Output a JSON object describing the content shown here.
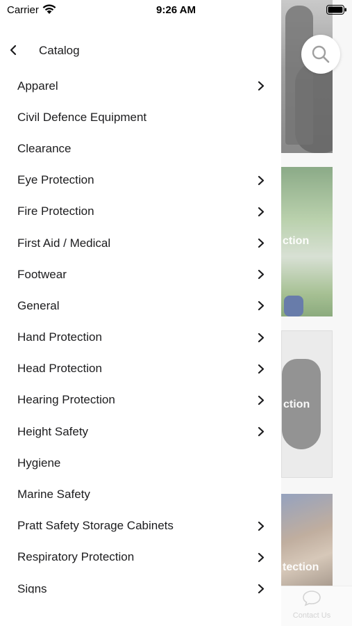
{
  "status_bar": {
    "carrier": "Carrier",
    "time": "9:26 AM"
  },
  "header": {
    "title": "Catalog"
  },
  "categories": [
    {
      "label": "Apparel",
      "has_children": true
    },
    {
      "label": "Civil Defence Equipment",
      "has_children": false
    },
    {
      "label": "Clearance",
      "has_children": false
    },
    {
      "label": "Eye Protection",
      "has_children": true
    },
    {
      "label": "Fire Protection",
      "has_children": true
    },
    {
      "label": "First Aid / Medical",
      "has_children": true
    },
    {
      "label": "Footwear",
      "has_children": true
    },
    {
      "label": "General",
      "has_children": true
    },
    {
      "label": "Hand Protection",
      "has_children": true
    },
    {
      "label": "Head Protection",
      "has_children": true
    },
    {
      "label": "Hearing Protection",
      "has_children": true
    },
    {
      "label": "Height Safety",
      "has_children": true
    },
    {
      "label": "Hygiene",
      "has_children": false
    },
    {
      "label": "Marine Safety",
      "has_children": false
    },
    {
      "label": "Pratt Safety Storage Cabinets",
      "has_children": true
    },
    {
      "label": "Respiratory Protection",
      "has_children": true
    },
    {
      "label": "Signs",
      "has_children": true
    }
  ],
  "background": {
    "card_captions": [
      "ction",
      "ction",
      "tection"
    ],
    "contact_tab_label": "Contact Us"
  },
  "colors": {
    "text": "#1c1c1e",
    "drawer_background": "#ffffff",
    "tab_inactive": "#c3c3c3"
  }
}
